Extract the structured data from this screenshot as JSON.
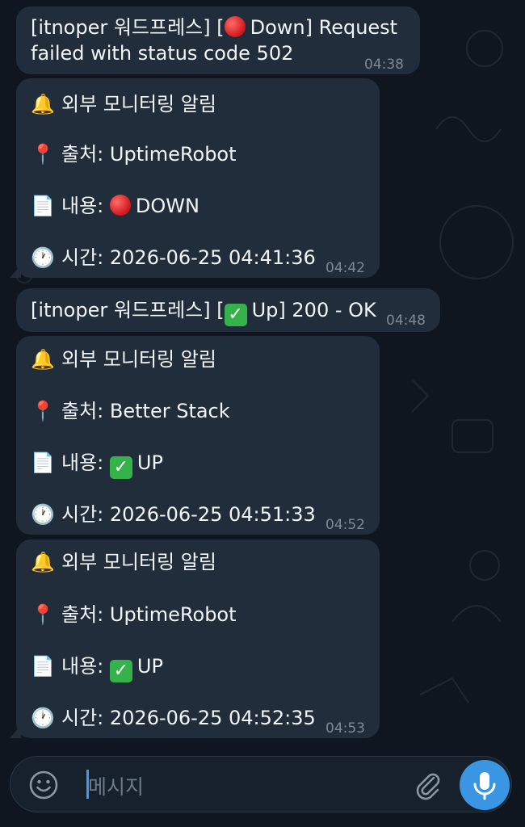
{
  "messages": [
    {
      "type": "simple",
      "text_prefix": "[itnoper 워드프레스] [",
      "status_word": "Down",
      "text_suffix_line1": "] Request",
      "line2": "failed with status code 502",
      "time": "04:38"
    },
    {
      "type": "alert",
      "title": "외부 모니터링 알림",
      "source_label": "출처:",
      "source": "UptimeRobot",
      "content_label": "내용:",
      "content_status": "DOWN",
      "status_kind": "down",
      "time_label": "시간:",
      "timestamp": "2026-06-25 04:41:36",
      "time": "04:42"
    },
    {
      "type": "simple",
      "text_prefix": "[itnoper 워드프레스] [",
      "status_word": "Up",
      "text_suffix": "] 200 - OK",
      "time": "04:48"
    },
    {
      "type": "alert",
      "title": "외부 모니터링 알림",
      "source_label": "출처:",
      "source": "Better Stack",
      "content_label": "내용:",
      "content_status": "UP",
      "status_kind": "up",
      "time_label": "시간:",
      "timestamp": "2026-06-25 04:51:33",
      "time": "04:52"
    },
    {
      "type": "alert",
      "title": "외부 모니터링 알림",
      "source_label": "출처:",
      "source": "UptimeRobot",
      "content_label": "내용:",
      "content_status": "UP",
      "status_kind": "up",
      "time_label": "시간:",
      "timestamp": "2026-06-25 04:52:35",
      "time": "04:53"
    }
  ],
  "input": {
    "placeholder": "메시지"
  },
  "icons": {
    "bell": "bell-icon",
    "pin": "pin-icon",
    "doc": "document-icon",
    "clock": "clock-icon",
    "emoji": "emoji-icon",
    "attach": "paperclip-icon",
    "mic": "microphone-icon"
  },
  "colors": {
    "background": "#0f1620",
    "bubble": "#212d3b",
    "accent": "#3a95e2",
    "meta": "#7c8a99"
  }
}
